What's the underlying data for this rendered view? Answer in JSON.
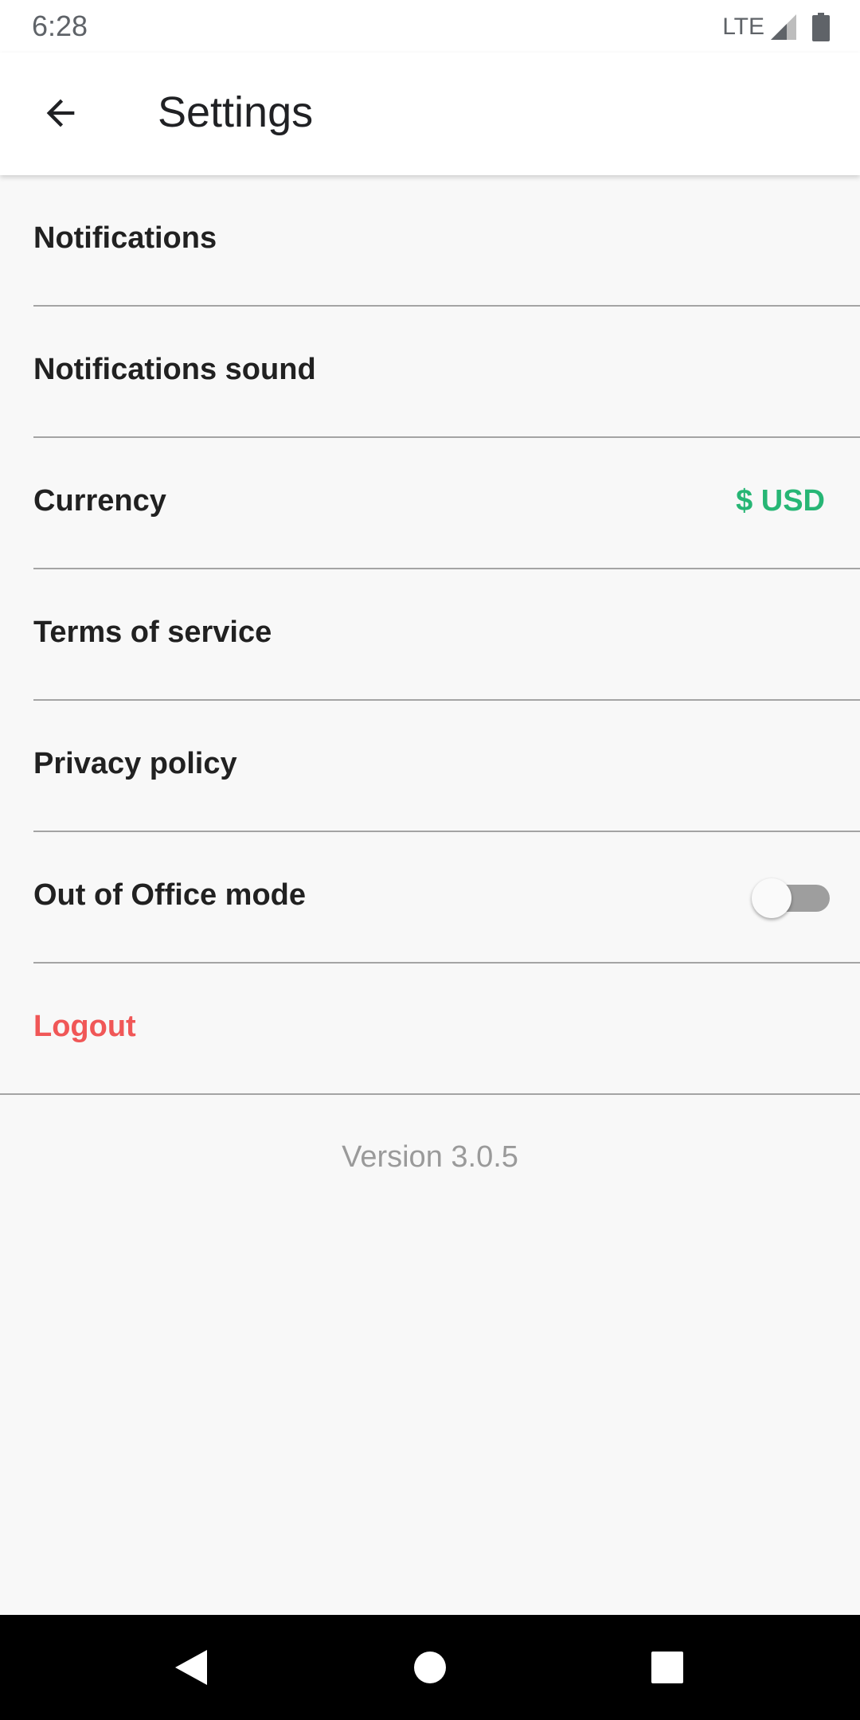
{
  "status_bar": {
    "time": "6:28",
    "network": "LTE",
    "icons": [
      "signal-icon",
      "battery-icon"
    ]
  },
  "app_bar": {
    "title": "Settings",
    "back_icon": "arrow-back-icon"
  },
  "settings": {
    "items": [
      {
        "label": "Notifications"
      },
      {
        "label": "Notifications sound"
      },
      {
        "label": "Currency",
        "value": "$ USD"
      },
      {
        "label": "Terms of service"
      },
      {
        "label": "Privacy policy"
      },
      {
        "label": "Out of Office mode",
        "toggle": false
      },
      {
        "label": "Logout"
      }
    ]
  },
  "footer": {
    "version": "Version 3.0.5"
  },
  "nav_bar": {
    "icons": [
      "back-triangle-icon",
      "home-circle-icon",
      "recents-square-icon"
    ]
  },
  "colors": {
    "accent_green": "#27b675",
    "logout_red": "#f05757",
    "background": "#f8f8f8",
    "text_primary": "#212121",
    "text_secondary": "#9a9a9a"
  }
}
